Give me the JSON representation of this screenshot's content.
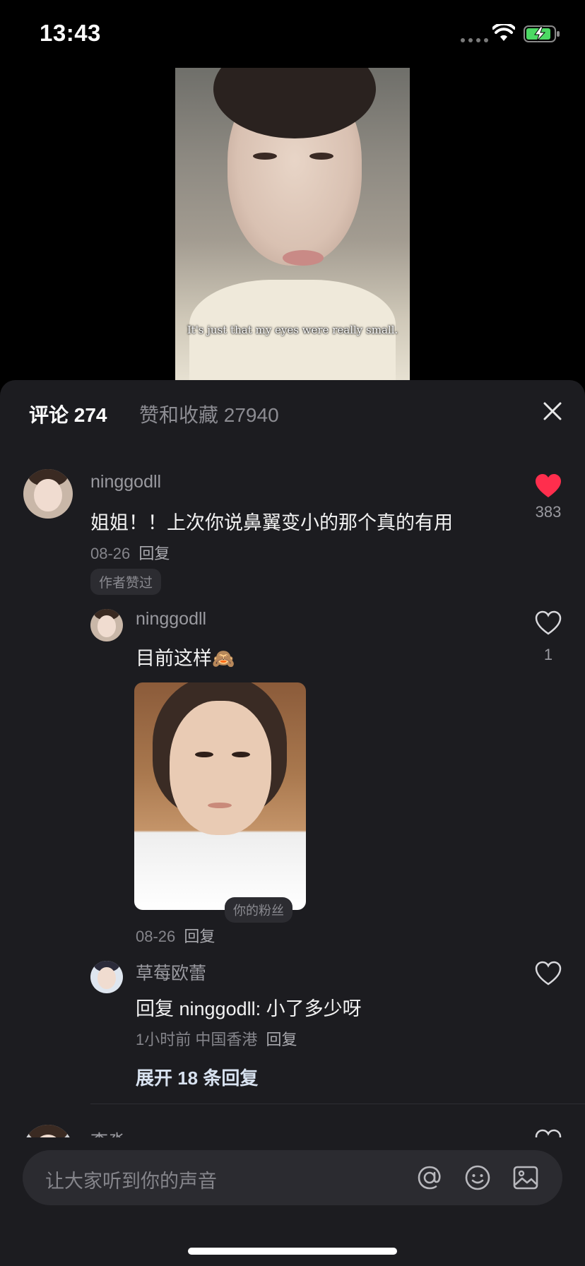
{
  "status_bar": {
    "time": "13:43"
  },
  "video": {
    "subtitle": "It's just that my eyes were really small."
  },
  "panel": {
    "tabs": [
      {
        "label": "评论 274"
      },
      {
        "label": "赞和收藏 27940"
      }
    ]
  },
  "comments": [
    {
      "username": "ninggodll",
      "text": "姐姐！！上次你说鼻翼变小的那个真的有用",
      "date": "08-26",
      "reply_label": "回复",
      "badge": "作者赞过",
      "likes": "383",
      "liked": true,
      "replies": [
        {
          "username": "ninggodll",
          "text": "目前这样",
          "emoji": "🙈",
          "date": "08-26",
          "reply_label": "回复",
          "likes": "1",
          "has_image": true
        },
        {
          "username": "草莓欧蕾",
          "fan_badge": "你的粉丝",
          "text": "回复 ninggodll: 小了多少呀",
          "meta": "1小时前 中国香港",
          "reply_label": "回复"
        }
      ],
      "expand_label": "展开 18 条回复"
    },
    {
      "username": "李淼"
    }
  ],
  "input": {
    "placeholder": "让大家听到你的声音"
  },
  "colors": {
    "like_red": "#ff2e4d",
    "panel_bg": "#1c1c20"
  }
}
